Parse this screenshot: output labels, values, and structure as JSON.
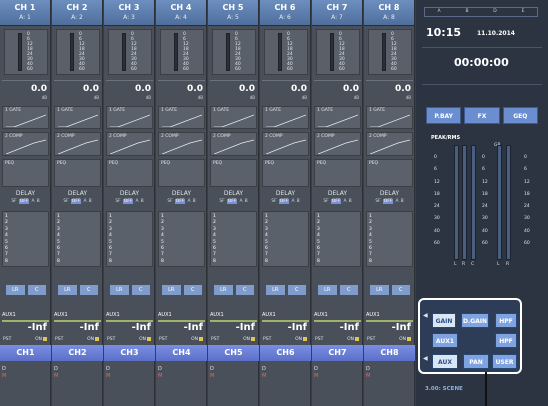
{
  "channels": [
    {
      "header": "CH 1",
      "ain": "A: 1",
      "gain": "0.0",
      "name": "CH1"
    },
    {
      "header": "CH 2",
      "ain": "A: 2",
      "gain": "0.0",
      "name": "CH2"
    },
    {
      "header": "CH 3",
      "ain": "A: 3",
      "gain": "0.0",
      "name": "CH3"
    },
    {
      "header": "CH 4",
      "ain": "A: 4",
      "gain": "0.0",
      "name": "CH4"
    },
    {
      "header": "CH 5",
      "ain": "A: 5",
      "gain": "0.0",
      "name": "CH5"
    },
    {
      "header": "CH 6",
      "ain": "A: 6",
      "gain": "0.0",
      "name": "CH6"
    },
    {
      "header": "CH 7",
      "ain": "A: 7",
      "gain": "0.0",
      "name": "CH7"
    },
    {
      "header": "CH 8",
      "ain": "A: 8",
      "gain": "0.0",
      "name": "CH8"
    }
  ],
  "strip": {
    "meter_scale": [
      "0",
      "6",
      "12",
      "18",
      "24",
      "30",
      "40",
      "60"
    ],
    "gain_unit": "dB",
    "gate_label": "1 GATE",
    "comp_label": "2 COMP",
    "peq_label": "PEQ",
    "delay_label": "DELAY",
    "delay_opts": [
      "SF",
      "OFF",
      "A",
      "B"
    ],
    "routing_nums": [
      "1",
      "2",
      "3",
      "4",
      "5",
      "6",
      "7",
      "8"
    ],
    "lr_label": "LR",
    "c_label": "C",
    "aux_label": "AUX1",
    "aux_value": "-Inf",
    "pst_label": "PST",
    "on_label": "ON",
    "d_label": "D",
    "m_label": "M"
  },
  "right_panel": {
    "abd": [
      "A",
      "B",
      "D",
      "E"
    ],
    "time": "10:15",
    "date": "11.10.2014",
    "timer": "00:00:00",
    "buttons": [
      "P.BAY",
      "FX",
      "GEQ"
    ],
    "peak_title": "PEAK/RMS",
    "gr_label": "GR",
    "meter_scale": [
      "0",
      "6",
      "12",
      "18",
      "24",
      "30",
      "40",
      "60"
    ],
    "lrc_labels": [
      "L",
      "R",
      "C"
    ],
    "param_buttons": [
      "GAIN",
      "D.GAIN",
      "HPF",
      "AUX1",
      "HPF",
      "AUX",
      "PAN",
      "USER"
    ],
    "scene": "3.00: SCENE"
  },
  "colors": {
    "channel_header": "#5b7bb0",
    "channel_name": "#6a7fdc",
    "delay_selected": "#7a8fd8",
    "panel_highlight_border": "#ffffff"
  }
}
